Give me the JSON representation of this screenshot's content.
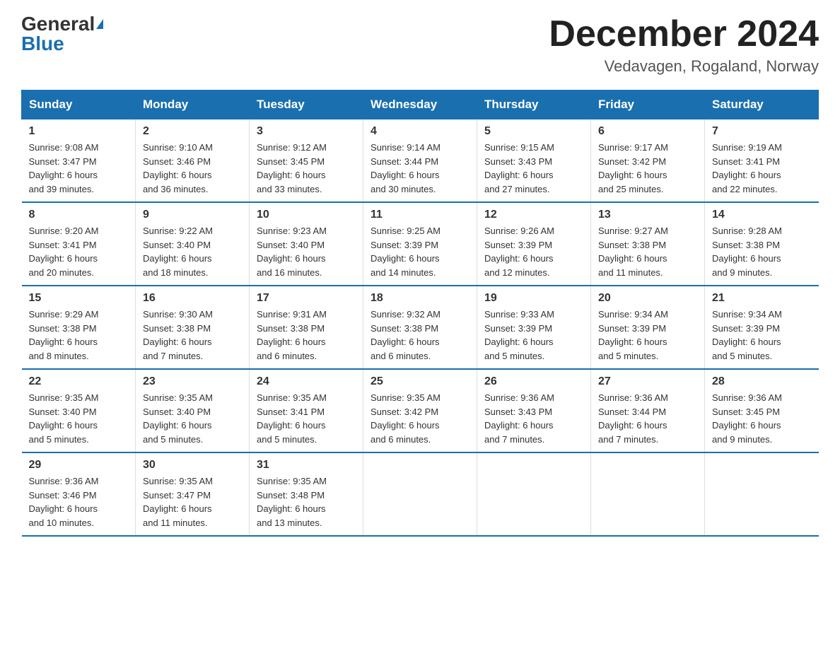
{
  "header": {
    "logo_general": "General",
    "logo_blue": "Blue",
    "month_title": "December 2024",
    "location": "Vedavagen, Rogaland, Norway"
  },
  "days_of_week": [
    "Sunday",
    "Monday",
    "Tuesday",
    "Wednesday",
    "Thursday",
    "Friday",
    "Saturday"
  ],
  "weeks": [
    [
      {
        "day": "1",
        "info": "Sunrise: 9:08 AM\nSunset: 3:47 PM\nDaylight: 6 hours\nand 39 minutes."
      },
      {
        "day": "2",
        "info": "Sunrise: 9:10 AM\nSunset: 3:46 PM\nDaylight: 6 hours\nand 36 minutes."
      },
      {
        "day": "3",
        "info": "Sunrise: 9:12 AM\nSunset: 3:45 PM\nDaylight: 6 hours\nand 33 minutes."
      },
      {
        "day": "4",
        "info": "Sunrise: 9:14 AM\nSunset: 3:44 PM\nDaylight: 6 hours\nand 30 minutes."
      },
      {
        "day": "5",
        "info": "Sunrise: 9:15 AM\nSunset: 3:43 PM\nDaylight: 6 hours\nand 27 minutes."
      },
      {
        "day": "6",
        "info": "Sunrise: 9:17 AM\nSunset: 3:42 PM\nDaylight: 6 hours\nand 25 minutes."
      },
      {
        "day": "7",
        "info": "Sunrise: 9:19 AM\nSunset: 3:41 PM\nDaylight: 6 hours\nand 22 minutes."
      }
    ],
    [
      {
        "day": "8",
        "info": "Sunrise: 9:20 AM\nSunset: 3:41 PM\nDaylight: 6 hours\nand 20 minutes."
      },
      {
        "day": "9",
        "info": "Sunrise: 9:22 AM\nSunset: 3:40 PM\nDaylight: 6 hours\nand 18 minutes."
      },
      {
        "day": "10",
        "info": "Sunrise: 9:23 AM\nSunset: 3:40 PM\nDaylight: 6 hours\nand 16 minutes."
      },
      {
        "day": "11",
        "info": "Sunrise: 9:25 AM\nSunset: 3:39 PM\nDaylight: 6 hours\nand 14 minutes."
      },
      {
        "day": "12",
        "info": "Sunrise: 9:26 AM\nSunset: 3:39 PM\nDaylight: 6 hours\nand 12 minutes."
      },
      {
        "day": "13",
        "info": "Sunrise: 9:27 AM\nSunset: 3:38 PM\nDaylight: 6 hours\nand 11 minutes."
      },
      {
        "day": "14",
        "info": "Sunrise: 9:28 AM\nSunset: 3:38 PM\nDaylight: 6 hours\nand 9 minutes."
      }
    ],
    [
      {
        "day": "15",
        "info": "Sunrise: 9:29 AM\nSunset: 3:38 PM\nDaylight: 6 hours\nand 8 minutes."
      },
      {
        "day": "16",
        "info": "Sunrise: 9:30 AM\nSunset: 3:38 PM\nDaylight: 6 hours\nand 7 minutes."
      },
      {
        "day": "17",
        "info": "Sunrise: 9:31 AM\nSunset: 3:38 PM\nDaylight: 6 hours\nand 6 minutes."
      },
      {
        "day": "18",
        "info": "Sunrise: 9:32 AM\nSunset: 3:38 PM\nDaylight: 6 hours\nand 6 minutes."
      },
      {
        "day": "19",
        "info": "Sunrise: 9:33 AM\nSunset: 3:39 PM\nDaylight: 6 hours\nand 5 minutes."
      },
      {
        "day": "20",
        "info": "Sunrise: 9:34 AM\nSunset: 3:39 PM\nDaylight: 6 hours\nand 5 minutes."
      },
      {
        "day": "21",
        "info": "Sunrise: 9:34 AM\nSunset: 3:39 PM\nDaylight: 6 hours\nand 5 minutes."
      }
    ],
    [
      {
        "day": "22",
        "info": "Sunrise: 9:35 AM\nSunset: 3:40 PM\nDaylight: 6 hours\nand 5 minutes."
      },
      {
        "day": "23",
        "info": "Sunrise: 9:35 AM\nSunset: 3:40 PM\nDaylight: 6 hours\nand 5 minutes."
      },
      {
        "day": "24",
        "info": "Sunrise: 9:35 AM\nSunset: 3:41 PM\nDaylight: 6 hours\nand 5 minutes."
      },
      {
        "day": "25",
        "info": "Sunrise: 9:35 AM\nSunset: 3:42 PM\nDaylight: 6 hours\nand 6 minutes."
      },
      {
        "day": "26",
        "info": "Sunrise: 9:36 AM\nSunset: 3:43 PM\nDaylight: 6 hours\nand 7 minutes."
      },
      {
        "day": "27",
        "info": "Sunrise: 9:36 AM\nSunset: 3:44 PM\nDaylight: 6 hours\nand 7 minutes."
      },
      {
        "day": "28",
        "info": "Sunrise: 9:36 AM\nSunset: 3:45 PM\nDaylight: 6 hours\nand 9 minutes."
      }
    ],
    [
      {
        "day": "29",
        "info": "Sunrise: 9:36 AM\nSunset: 3:46 PM\nDaylight: 6 hours\nand 10 minutes."
      },
      {
        "day": "30",
        "info": "Sunrise: 9:35 AM\nSunset: 3:47 PM\nDaylight: 6 hours\nand 11 minutes."
      },
      {
        "day": "31",
        "info": "Sunrise: 9:35 AM\nSunset: 3:48 PM\nDaylight: 6 hours\nand 13 minutes."
      },
      {
        "day": "",
        "info": ""
      },
      {
        "day": "",
        "info": ""
      },
      {
        "day": "",
        "info": ""
      },
      {
        "day": "",
        "info": ""
      }
    ]
  ]
}
